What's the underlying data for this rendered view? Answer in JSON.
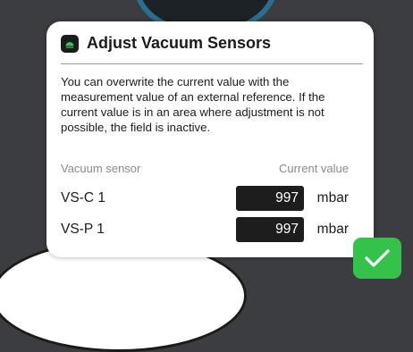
{
  "dialog": {
    "title": "Adjust Vacuum Sensors",
    "description": "You can overwrite the current value with the measurement value of an external reference. If the current value is in an area where adjustment is not possible, the field is inactive.",
    "col_sensor": "Vacuum sensor",
    "col_value": "Current value",
    "rows": [
      {
        "label": "VS-C 1",
        "value": "997",
        "unit": "mbar"
      },
      {
        "label": "VS-P 1",
        "value": "997",
        "unit": "mbar"
      }
    ]
  },
  "colors": {
    "confirm": "#34c24a",
    "field_bg": "#1d1d1d",
    "title_icon_accent": "#3fbf5a"
  },
  "icons": {
    "title": "vacuum-gauge-icon",
    "confirm": "checkmark-icon"
  }
}
